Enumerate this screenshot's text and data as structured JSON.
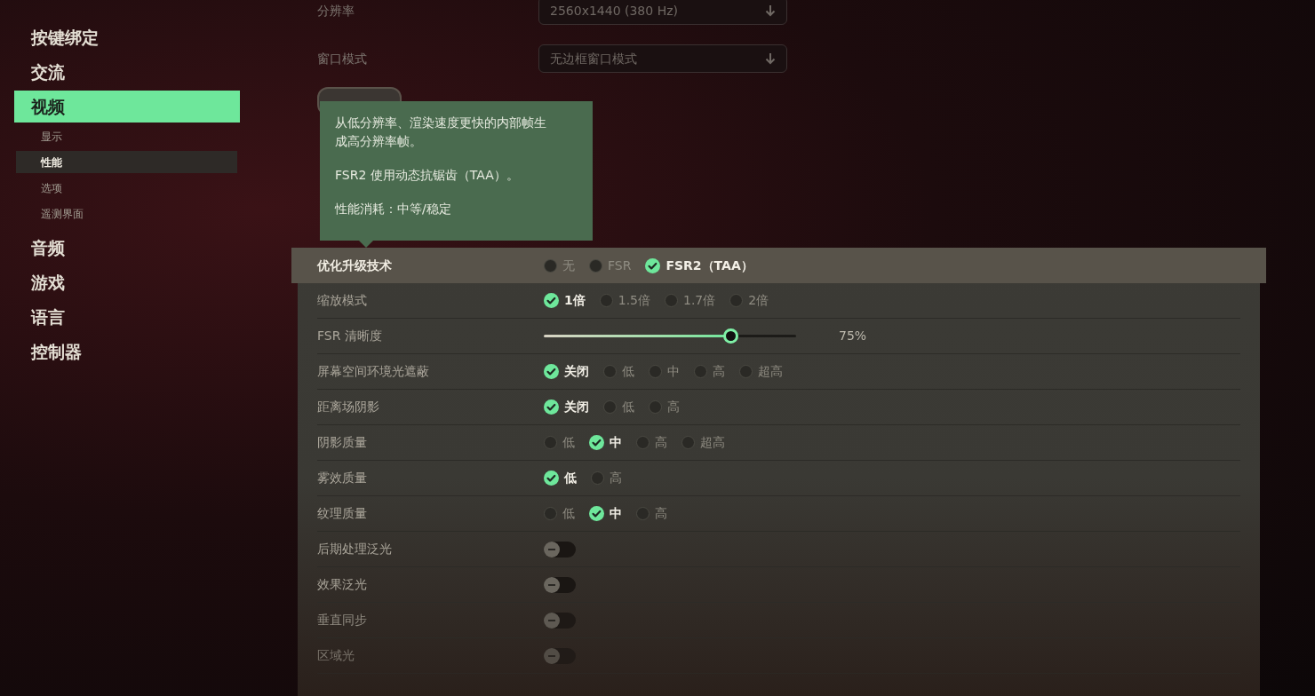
{
  "sidebar": {
    "items": [
      {
        "label": "按键绑定",
        "selected": false
      },
      {
        "label": "交流",
        "selected": false
      },
      {
        "label": "视频",
        "selected": true,
        "children": [
          {
            "label": "显示",
            "selected": false
          },
          {
            "label": "性能",
            "selected": true
          },
          {
            "label": "选项",
            "selected": false
          },
          {
            "label": "遥测界面",
            "selected": false
          }
        ]
      },
      {
        "label": "音频",
        "selected": false
      },
      {
        "label": "游戏",
        "selected": false
      },
      {
        "label": "语言",
        "selected": false
      },
      {
        "label": "控制器",
        "selected": false
      }
    ]
  },
  "display_settings": [
    {
      "label": "分辨率",
      "value": "2560x1440 (380 Hz)"
    },
    {
      "label": "窗口模式",
      "value": "无边框窗口模式"
    }
  ],
  "tooltip": {
    "paragraphs": [
      "从低分辨率、渲染速度更快的内部帧生成高分辨率帧。",
      "FSR2 使用动态抗锯齿（TAA）。",
      "性能消耗：中等/稳定"
    ]
  },
  "settings": [
    {
      "kind": "radio",
      "label": "优化升级技术",
      "highlighted": true,
      "options": [
        {
          "label": "无",
          "selected": false
        },
        {
          "label": "FSR",
          "selected": false
        },
        {
          "label": "FSR2（TAA）",
          "selected": true
        }
      ]
    },
    {
      "kind": "radio",
      "label": "缩放模式",
      "highlighted": false,
      "options": [
        {
          "label": "1倍",
          "selected": true
        },
        {
          "label": "1.5倍",
          "selected": false
        },
        {
          "label": "1.7倍",
          "selected": false
        },
        {
          "label": "2倍",
          "selected": false
        }
      ]
    },
    {
      "kind": "slider",
      "label": "FSR 清晰度",
      "highlighted": false,
      "level": 0.74,
      "reading": "75%"
    },
    {
      "kind": "radio",
      "label": "屏幕空间环境光遮蔽",
      "highlighted": false,
      "options": [
        {
          "label": "关闭",
          "selected": true
        },
        {
          "label": "低",
          "selected": false
        },
        {
          "label": "中",
          "selected": false
        },
        {
          "label": "高",
          "selected": false
        },
        {
          "label": "超高",
          "selected": false
        }
      ]
    },
    {
      "kind": "radio",
      "label": "距离场阴影",
      "highlighted": false,
      "options": [
        {
          "label": "关闭",
          "selected": true
        },
        {
          "label": "低",
          "selected": false
        },
        {
          "label": "高",
          "selected": false
        }
      ]
    },
    {
      "kind": "radio",
      "label": "阴影质量",
      "highlighted": false,
      "options": [
        {
          "label": "低",
          "selected": false
        },
        {
          "label": "中",
          "selected": true
        },
        {
          "label": "高",
          "selected": false
        },
        {
          "label": "超高",
          "selected": false
        }
      ]
    },
    {
      "kind": "radio",
      "label": "雾效质量",
      "highlighted": false,
      "options": [
        {
          "label": "低",
          "selected": true
        },
        {
          "label": "高",
          "selected": false
        }
      ]
    },
    {
      "kind": "radio",
      "label": "纹理质量",
      "highlighted": false,
      "options": [
        {
          "label": "低",
          "selected": false
        },
        {
          "label": "中",
          "selected": true
        },
        {
          "label": "高",
          "selected": false
        }
      ]
    },
    {
      "kind": "toggle",
      "label": "后期处理泛光",
      "highlighted": false,
      "on": false
    },
    {
      "kind": "toggle",
      "label": "效果泛光",
      "highlighted": false,
      "on": false
    },
    {
      "kind": "toggle",
      "label": "垂直同步",
      "highlighted": false,
      "on": false
    },
    {
      "kind": "toggle",
      "label": "区域光",
      "highlighted": false,
      "on": false
    }
  ]
}
